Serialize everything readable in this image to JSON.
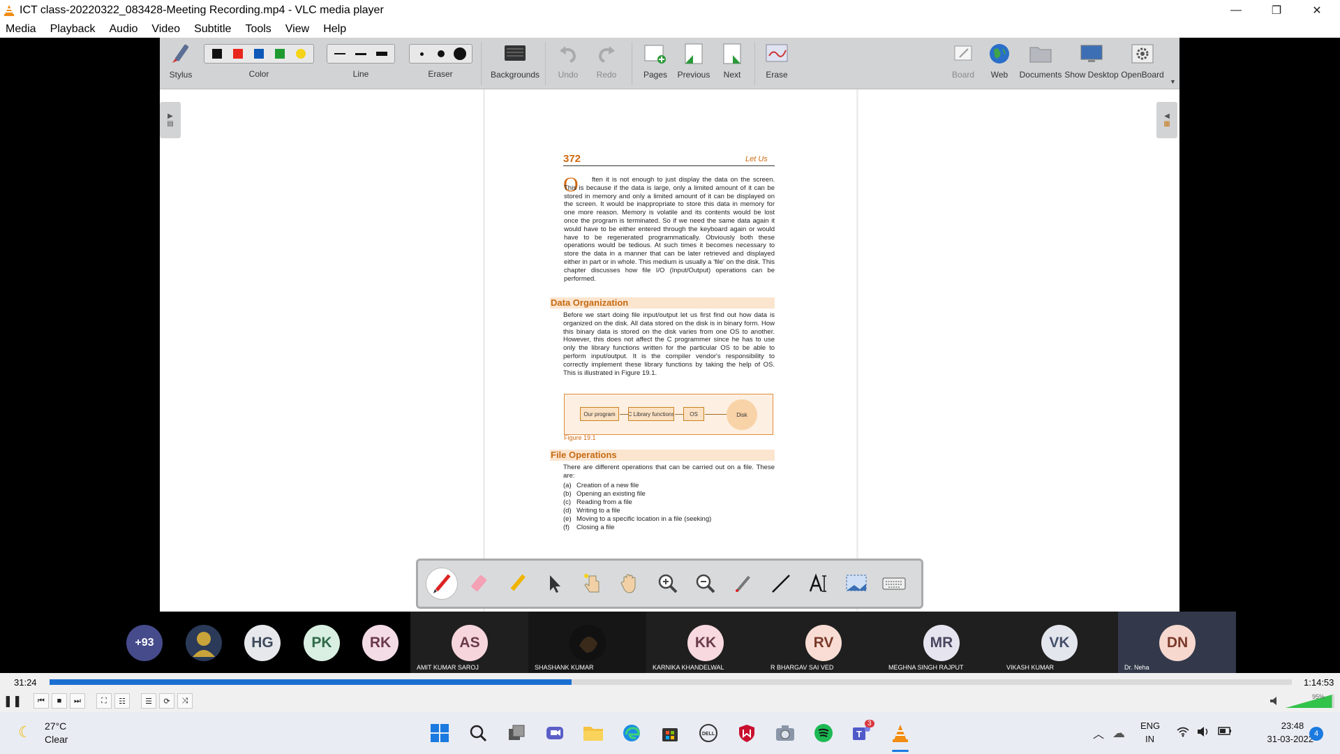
{
  "window": {
    "title": "ICT class-20220322_083428-Meeting Recording.mp4 - VLC media player",
    "controls": {
      "minimize": "—",
      "restore": "❐",
      "close": "✕"
    }
  },
  "menu": [
    "Media",
    "Playback",
    "Audio",
    "Video",
    "Subtitle",
    "Tools",
    "View",
    "Help"
  ],
  "toolbar": {
    "stylus": "Stylus",
    "color": "Color",
    "colors": [
      "#111111",
      "#e8261b",
      "#0d57b8",
      "#1f9a2f",
      "#f5d316"
    ],
    "line": "Line",
    "eraser": "Eraser",
    "backgrounds": "Backgrounds",
    "undo": "Undo",
    "redo": "Redo",
    "pages": "Pages",
    "previous": "Previous",
    "next": "Next",
    "erase": "Erase",
    "board": "Board",
    "web": "Web",
    "documents": "Documents",
    "show_desktop": "Show Desktop",
    "openboard": "OpenBoard"
  },
  "doc": {
    "page_number": "372",
    "page_header_right": "Let Us",
    "dropcap": "O",
    "intro": "ften it is not enough to just display the data on the screen. This is because if the data is large, only a limited amount of it can be stored in memory and only a limited amount of it can be displayed on the screen. It would be inappropriate to store this data in memory for one more reason. Memory is volatile and its contents would be lost once the program is terminated. So if we need the same data again it would have to be either entered through the keyboard again or would have to be regenerated programmatically. Obviously both these operations would be tedious. At such times it becomes necessary to store the data in a manner that can be later retrieved and displayed either in part or in whole. This medium is usually a 'file' on the disk. This chapter discusses how file I/O (Input/Output) operations can be performed.",
    "section1_title": "Data Organization",
    "section1_body": "Before we start doing file input/output let us first find out how data is organized on the disk. All data stored on the disk is in binary form. How this binary data is stored on the disk varies from one OS to another. However, this does not affect the C programmer since he has to use only the library functions written for the particular OS to be able to perform input/output. It is the compiler vendor's responsibility to correctly implement these library functions by taking the help of OS. This is illustrated in Figure 19.1.",
    "figure": {
      "boxes": [
        "Our program",
        "C Library functions",
        "OS",
        "Disk"
      ],
      "caption": "Figure 19.1"
    },
    "section2_title": "File Operations",
    "section2_intro": "There are different operations that can be carried out on a file. These are:",
    "operations": [
      {
        "marker": "(a)",
        "text": "Creation of a new file"
      },
      {
        "marker": "(b)",
        "text": "Opening an existing file"
      },
      {
        "marker": "(c)",
        "text": "Reading from a file"
      },
      {
        "marker": "(d)",
        "text": "Writing to a file"
      },
      {
        "marker": "(e)",
        "text": "Moving to a specific location in a file (seeking)"
      },
      {
        "marker": "(f)",
        "text": "Closing a file"
      }
    ]
  },
  "participants": {
    "more_count": "+93",
    "initials": [
      "HG",
      "PK",
      "RK"
    ],
    "tiles": [
      {
        "initials": "AS",
        "name": "AMIT KUMAR SAROJ"
      },
      {
        "initials": "",
        "name": "SHASHANK KUMAR"
      },
      {
        "initials": "KK",
        "name": "KARNIKA KHANDELWAL"
      },
      {
        "initials": "RV",
        "name": "R BHARGAV SAI VED"
      },
      {
        "initials": "MR",
        "name": "MEGHNA SINGH RAJPUT"
      },
      {
        "initials": "VK",
        "name": "VIKASH KUMAR"
      },
      {
        "initials": "DN",
        "name": "Dr. Neha"
      }
    ]
  },
  "player": {
    "elapsed": "31:24",
    "total": "1:14:53",
    "progress": 0.42,
    "volume": "95%",
    "volume_level": 0.95
  },
  "taskbar": {
    "temperature": "27°C",
    "condition": "Clear",
    "language": "ENG",
    "region": "IN",
    "time": "23:48",
    "date": "31-03-2022",
    "notification_count": "4",
    "teams_badge": "3"
  }
}
